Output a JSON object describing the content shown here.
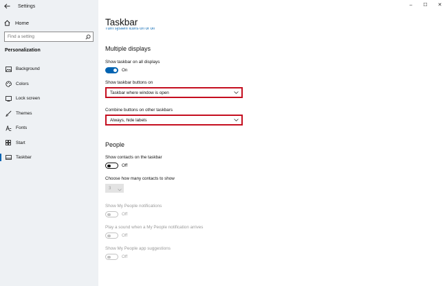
{
  "window": {
    "title": "Settings",
    "controls": [
      "–",
      "☐",
      "✕"
    ]
  },
  "sidebar": {
    "home_label": "Home",
    "search_placeholder": "Find a setting",
    "section_title": "Personalization",
    "items": [
      {
        "label": "Background",
        "icon": "image-icon"
      },
      {
        "label": "Colors",
        "icon": "palette-icon"
      },
      {
        "label": "Lock screen",
        "icon": "lock-screen-icon"
      },
      {
        "label": "Themes",
        "icon": "brush-icon"
      },
      {
        "label": "Fonts",
        "icon": "font-icon"
      },
      {
        "label": "Start",
        "icon": "start-icon"
      },
      {
        "label": "Taskbar",
        "icon": "taskbar-icon",
        "active": true
      }
    ]
  },
  "main": {
    "title": "Taskbar",
    "cut_text": "Turn system icons on or off",
    "multiple_displays": {
      "heading": "Multiple displays",
      "show_all_label": "Show taskbar on all displays",
      "show_all_state": "On",
      "buttons_on_label": "Show taskbar buttons on",
      "buttons_on_value": "Taskbar where window is open",
      "combine_label": "Combine buttons on other taskbars",
      "combine_value": "Always, hide labels"
    },
    "people": {
      "heading": "People",
      "contacts_label": "Show contacts on the taskbar",
      "contacts_state": "Off",
      "how_many_label": "Choose how many contacts to show",
      "how_many_value": "3",
      "notifications_label": "Show My People notifications",
      "notifications_state": "Off",
      "sound_label": "Play a sound when a My People notification arrives",
      "sound_state": "Off",
      "suggestions_label": "Show My People app suggestions",
      "suggestions_state": "Off"
    }
  },
  "colors": {
    "accent": "#0063b1",
    "highlight_border": "#c40d1e",
    "sidebar_bg": "#eef1f4"
  }
}
